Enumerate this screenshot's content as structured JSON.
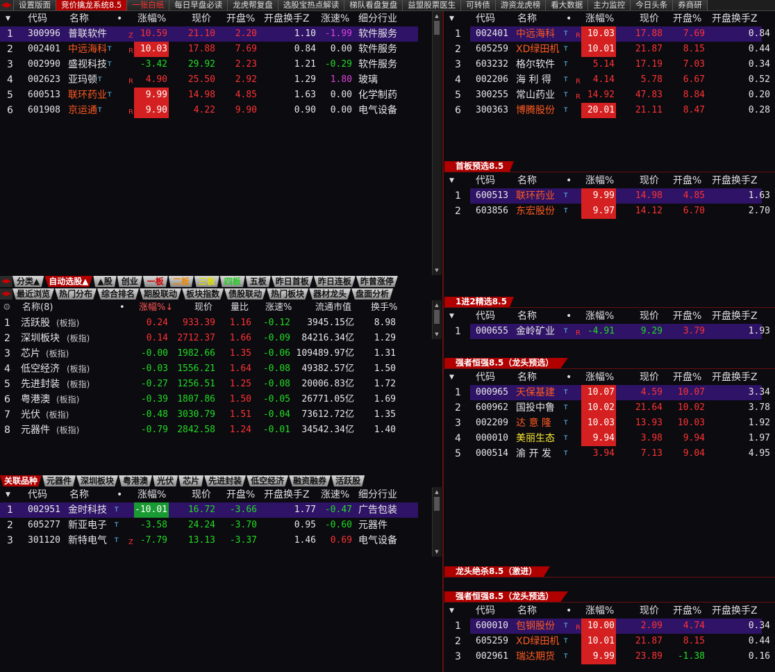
{
  "topbar": {
    "tabs": [
      "设置版面",
      "竞价擒龙系统8.5",
      "一张白纸",
      "每日早盘必读",
      "龙虎帮复盘",
      "选股宝热点解读",
      "梯队看盘复盘",
      "益盟股票医生",
      "可转债",
      "游资龙虎榜",
      "看大数据",
      "主力监控",
      "今日头条",
      "券商研"
    ],
    "active_index": 1
  },
  "headers": {
    "code": "代码",
    "name": "名称",
    "dot": "•",
    "chg": "涨幅%",
    "price": "现价",
    "open": "开盘%",
    "open_turn": "开盘换手Z",
    "speed": "涨速%",
    "industry": "细分行业"
  },
  "panelA": {
    "rows": [
      {
        "idx": "1",
        "code": "300996",
        "name": "普联软件",
        "tag": "Z",
        "chg": "10.59",
        "price": "21.10",
        "open": "2.20",
        "turn": "1.10",
        "speed": "-1.99",
        "ind": "软件服务",
        "nameColor": "w",
        "chgBox": "none",
        "chgColor": "r",
        "priceColor": "r",
        "openColor": "r",
        "speedColor": "m",
        "hl": true,
        "sup": ""
      },
      {
        "idx": "2",
        "code": "002401",
        "name": "中远海科",
        "tag": "R",
        "chg": "10.03",
        "price": "17.88",
        "open": "7.69",
        "turn": "0.84",
        "speed": "0.00",
        "ind": "软件服务",
        "nameColor": "orange",
        "chgBox": "red",
        "chgColor": "w",
        "priceColor": "r",
        "openColor": "r",
        "speedColor": "w",
        "hl": false,
        "sup": "T"
      },
      {
        "idx": "3",
        "code": "002990",
        "name": "盛视科技",
        "tag": "",
        "chg": "-3.42",
        "price": "29.92",
        "open": "2.23",
        "turn": "1.21",
        "speed": "-0.29",
        "ind": "软件服务",
        "nameColor": "w",
        "chgBox": "none",
        "chgColor": "g",
        "priceColor": "g",
        "openColor": "r",
        "speedColor": "g",
        "hl": false,
        "sup": "T"
      },
      {
        "idx": "4",
        "code": "002623",
        "name": "亚玛顿",
        "tag": "R",
        "chg": "4.90",
        "price": "25.50",
        "open": "2.92",
        "turn": "1.29",
        "speed": "1.80",
        "ind": "玻璃",
        "nameColor": "w",
        "chgBox": "none",
        "chgColor": "r",
        "priceColor": "r",
        "openColor": "r",
        "speedColor": "m",
        "hl": false,
        "sup": "T"
      },
      {
        "idx": "5",
        "code": "600513",
        "name": "联环药业",
        "tag": "",
        "chg": "9.99",
        "price": "14.98",
        "open": "4.85",
        "turn": "1.63",
        "speed": "0.00",
        "ind": "化学制药",
        "nameColor": "orange",
        "chgBox": "red",
        "chgColor": "w",
        "priceColor": "r",
        "openColor": "r",
        "speedColor": "w",
        "hl": false,
        "sup": "T"
      },
      {
        "idx": "6",
        "code": "601908",
        "name": "京运通",
        "tag": "R",
        "chg": "9.90",
        "price": "4.22",
        "open": "9.90",
        "turn": "0.90",
        "speed": "0.00",
        "ind": "电气设备",
        "nameColor": "orange",
        "chgBox": "red",
        "chgColor": "w",
        "priceColor": "r",
        "openColor": "r",
        "speedColor": "w",
        "hl": false,
        "sup": "T"
      }
    ]
  },
  "panelB": {
    "rows": [
      {
        "idx": "1",
        "code": "002401",
        "name": "中远海科",
        "tag": "R",
        "chg": "10.03",
        "price": "17.88",
        "open": "7.69",
        "turn": "0.84",
        "nameColor": "orange",
        "chgBox": "red",
        "hl": true
      },
      {
        "idx": "2",
        "code": "605259",
        "name": "XD绿田机",
        "tag": "",
        "chg": "10.01",
        "price": "21.87",
        "open": "8.15",
        "turn": "0.44",
        "nameColor": "orange",
        "chgBox": "red",
        "hl": false
      },
      {
        "idx": "3",
        "code": "603232",
        "name": "格尔软件",
        "tag": "",
        "chg": "5.14",
        "price": "17.19",
        "open": "7.03",
        "turn": "0.34",
        "nameColor": "w",
        "chgBox": "none",
        "hl": false
      },
      {
        "idx": "4",
        "code": "002206",
        "name": "海 利 得",
        "tag": "R",
        "chg": "4.14",
        "price": "5.78",
        "open": "6.67",
        "turn": "0.52",
        "nameColor": "w",
        "chgBox": "none",
        "hl": false
      },
      {
        "idx": "5",
        "code": "300255",
        "name": "常山药业",
        "tag": "R",
        "chg": "14.92",
        "price": "47.83",
        "open": "8.84",
        "turn": "0.20",
        "nameColor": "w",
        "chgBox": "none",
        "hl": false
      },
      {
        "idx": "6",
        "code": "300363",
        "name": "博腾股份",
        "tag": "",
        "chg": "20.01",
        "price": "21.11",
        "open": "8.47",
        "turn": "0.28",
        "nameColor": "orange",
        "chgBox": "red",
        "hl": false
      }
    ]
  },
  "section1": {
    "title": "首板预选8.5",
    "rows": [
      {
        "idx": "1",
        "code": "600513",
        "name": "联环药业",
        "chg": "9.99",
        "price": "14.98",
        "open": "4.85",
        "turn": "1.63",
        "nameColor": "orange",
        "hl": true
      },
      {
        "idx": "2",
        "code": "603856",
        "name": "东宏股份",
        "chg": "9.97",
        "price": "14.12",
        "open": "6.70",
        "turn": "2.70",
        "nameColor": "orange",
        "hl": false
      }
    ]
  },
  "section2": {
    "title": "1进2精选8.5",
    "rows": [
      {
        "idx": "1",
        "code": "000655",
        "name": "金岭矿业",
        "tag": "R",
        "chg": "-4.91",
        "price": "9.29",
        "open": "3.79",
        "turn": "1.93",
        "hl": true
      }
    ]
  },
  "section3": {
    "title": "强者恒强8.5（龙头预选）",
    "rows": [
      {
        "idx": "1",
        "code": "000965",
        "name": "天保基建",
        "chg": "10.07",
        "price": "4.59",
        "open": "10.07",
        "turn": "3.34",
        "nameColor": "orange",
        "box": "red",
        "priceColor": "r",
        "hl": true
      },
      {
        "idx": "2",
        "code": "600962",
        "name": "国投中鲁",
        "chg": "10.02",
        "price": "21.64",
        "open": "10.02",
        "turn": "3.78",
        "nameColor": "w",
        "box": "red",
        "priceColor": "r",
        "hl": false
      },
      {
        "idx": "3",
        "code": "002209",
        "name": "达 意 隆",
        "chg": "10.03",
        "price": "13.93",
        "open": "10.03",
        "turn": "1.92",
        "nameColor": "orange",
        "box": "red",
        "priceColor": "r",
        "hl": false
      },
      {
        "idx": "4",
        "code": "000010",
        "name": "美丽生态",
        "chg": "9.94",
        "price": "3.98",
        "open": "9.94",
        "turn": "1.97",
        "nameColor": "y",
        "box": "red",
        "priceColor": "r",
        "hl": false
      },
      {
        "idx": "5",
        "code": "000514",
        "name": "渝 开 发",
        "chg": "3.94",
        "price": "7.13",
        "open": "9.04",
        "turn": "4.95",
        "nameColor": "w",
        "box": "none",
        "priceColor": "r",
        "hl": false
      }
    ]
  },
  "section4": {
    "title": "龙头绝杀8.5（激进）"
  },
  "section5": {
    "title": "强者恒强8.5（龙头预选）",
    "rows": [
      {
        "idx": "1",
        "code": "600010",
        "name": "包钢股份",
        "tag": "R",
        "chg": "10.00",
        "price": "2.09",
        "open": "4.74",
        "turn": "0.34",
        "nameColor": "orange",
        "openColor": "r",
        "hl": true
      },
      {
        "idx": "2",
        "code": "605259",
        "name": "XD绿田机",
        "tag": "",
        "chg": "10.01",
        "price": "21.87",
        "open": "8.15",
        "turn": "0.44",
        "nameColor": "orange",
        "openColor": "r",
        "hl": false
      },
      {
        "idx": "3",
        "code": "002961",
        "name": "瑞达期货",
        "tag": "",
        "chg": "9.99",
        "price": "23.89",
        "open": "-1.38",
        "turn": "0.16",
        "nameColor": "orange",
        "openColor": "g",
        "hl": false
      }
    ]
  },
  "strip1": {
    "buttons": [
      "分类▲",
      "自动选股▲",
      "▲股",
      "创业",
      "一板",
      "二板",
      "三板",
      "四板",
      "五板",
      "昨日首板",
      "昨日连板",
      "昨曾涨停"
    ]
  },
  "strip2": {
    "buttons": [
      "最近浏览",
      "热门分布",
      "综合排名",
      "期股联动",
      "板块指数",
      "债股联动",
      "热门板块",
      "器材龙头",
      "盘面分析"
    ]
  },
  "sector": {
    "headers": {
      "name": "名称(8)",
      "dot": "•",
      "chg": "涨幅%↓",
      "price": "现价",
      "vol": "量比",
      "speed": "涨速%",
      "cap": "流通市值",
      "turn": "换手%"
    },
    "rows": [
      {
        "idx": "1",
        "name": "活跃股",
        "tag": "(板指)",
        "chg": "0.24",
        "price": "933.39",
        "vol": "1.16",
        "speed": "-0.12",
        "cap": "3945.15亿",
        "turn": "8.98",
        "pos": true
      },
      {
        "idx": "2",
        "name": "深圳板块",
        "tag": "(板指)",
        "chg": "0.14",
        "price": "2712.37",
        "vol": "1.66",
        "speed": "-0.09",
        "cap": "84216.34亿",
        "turn": "1.29",
        "pos": true
      },
      {
        "idx": "3",
        "name": "芯片",
        "tag": "(板指)",
        "chg": "-0.00",
        "price": "1982.66",
        "vol": "1.35",
        "speed": "-0.06",
        "cap": "109489.97亿",
        "turn": "1.31",
        "pos": false
      },
      {
        "idx": "4",
        "name": "低空经济",
        "tag": "(板指)",
        "chg": "-0.03",
        "price": "1556.21",
        "vol": "1.64",
        "speed": "-0.08",
        "cap": "49382.57亿",
        "turn": "1.50",
        "pos": false
      },
      {
        "idx": "5",
        "name": "先进封装",
        "tag": "(板指)",
        "chg": "-0.27",
        "price": "1256.51",
        "vol": "1.25",
        "speed": "-0.08",
        "cap": "20006.83亿",
        "turn": "1.72",
        "pos": false
      },
      {
        "idx": "6",
        "name": "粤港澳",
        "tag": "(板指)",
        "chg": "-0.39",
        "price": "1807.86",
        "vol": "1.50",
        "speed": "-0.05",
        "cap": "26771.05亿",
        "turn": "1.69",
        "pos": false
      },
      {
        "idx": "7",
        "name": "光伏",
        "tag": "(板指)",
        "chg": "-0.48",
        "price": "3030.79",
        "vol": "1.51",
        "speed": "-0.04",
        "cap": "73612.72亿",
        "turn": "1.35",
        "pos": false
      },
      {
        "idx": "8",
        "name": "元器件",
        "tag": "(板指)",
        "chg": "-0.79",
        "price": "2842.58",
        "vol": "1.24",
        "speed": "-0.01",
        "cap": "34542.34亿",
        "turn": "1.40",
        "pos": false
      }
    ]
  },
  "strip3": {
    "buttons": [
      "关联品种",
      "元器件",
      "深圳板块",
      "粤港澳",
      "光伏",
      "芯片",
      "先进封装",
      "低空经济",
      "融资融券",
      "活跃股"
    ]
  },
  "panelC": {
    "rows": [
      {
        "idx": "1",
        "code": "002951",
        "name": "金时科技",
        "tag": "",
        "chg": "-10.01",
        "price": "16.72",
        "open": "-3.66",
        "turn": "1.77",
        "speed": "-0.47",
        "ind": "广告包装",
        "box": "green",
        "speedColor": "g",
        "hl": true
      },
      {
        "idx": "2",
        "code": "605277",
        "name": "新亚电子",
        "tag": "",
        "chg": "-3.58",
        "price": "24.24",
        "open": "-3.70",
        "turn": "0.95",
        "speed": "-0.60",
        "ind": "元器件",
        "box": "none",
        "speedColor": "g",
        "hl": false
      },
      {
        "idx": "3",
        "code": "301120",
        "name": "新特电气",
        "tag": "Z",
        "chg": "-7.79",
        "price": "13.13",
        "open": "-3.37",
        "turn": "1.46",
        "speed": "0.69",
        "ind": "电气设备",
        "box": "none",
        "speedColor": "r",
        "hl": false
      }
    ]
  }
}
